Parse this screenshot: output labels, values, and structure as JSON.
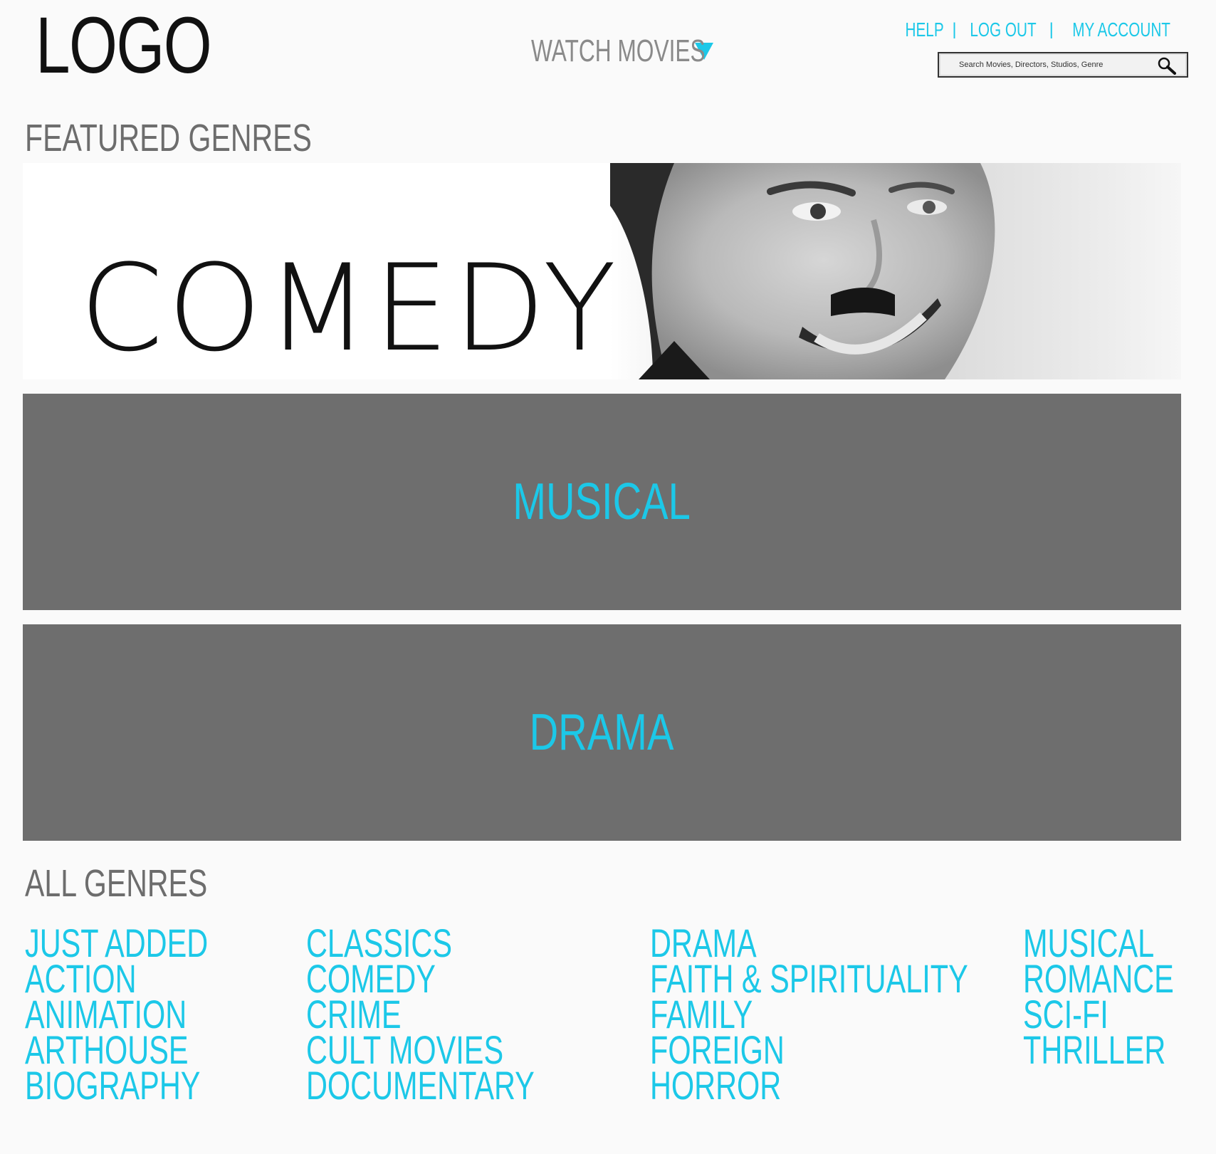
{
  "header": {
    "logo": "LOGO",
    "watch_movies": "WATCH MOVIES",
    "links": {
      "help": "HELP",
      "log_out": "LOG OUT",
      "my_account": "MY ACCOUNT",
      "separator": "|"
    },
    "search": {
      "placeholder": "Search Movies, Directors, Studios, Genre",
      "icon": "search-icon"
    },
    "accent_color": "#1cc8e8"
  },
  "featured": {
    "title": "FEATURED GENRES",
    "banners": [
      {
        "label": "COMEDY",
        "style": "image"
      },
      {
        "label": "MUSICAL",
        "style": "gray"
      },
      {
        "label": "DRAMA",
        "style": "gray"
      }
    ]
  },
  "all_genres": {
    "title": "ALL GENRES",
    "columns": [
      [
        "JUST ADDED",
        "ACTION",
        "ANIMATION",
        "ARTHOUSE",
        "BIOGRAPHY"
      ],
      [
        "CLASSICS",
        "COMEDY",
        "CRIME",
        "CULT MOVIES",
        "DOCUMENTARY"
      ],
      [
        "DRAMA",
        "FAITH & SPIRITUALITY",
        "FAMILY",
        "FOREIGN",
        "HORROR"
      ],
      [
        "MUSICAL",
        "ROMANCE",
        "SCI-FI",
        "THRILLER"
      ]
    ]
  }
}
